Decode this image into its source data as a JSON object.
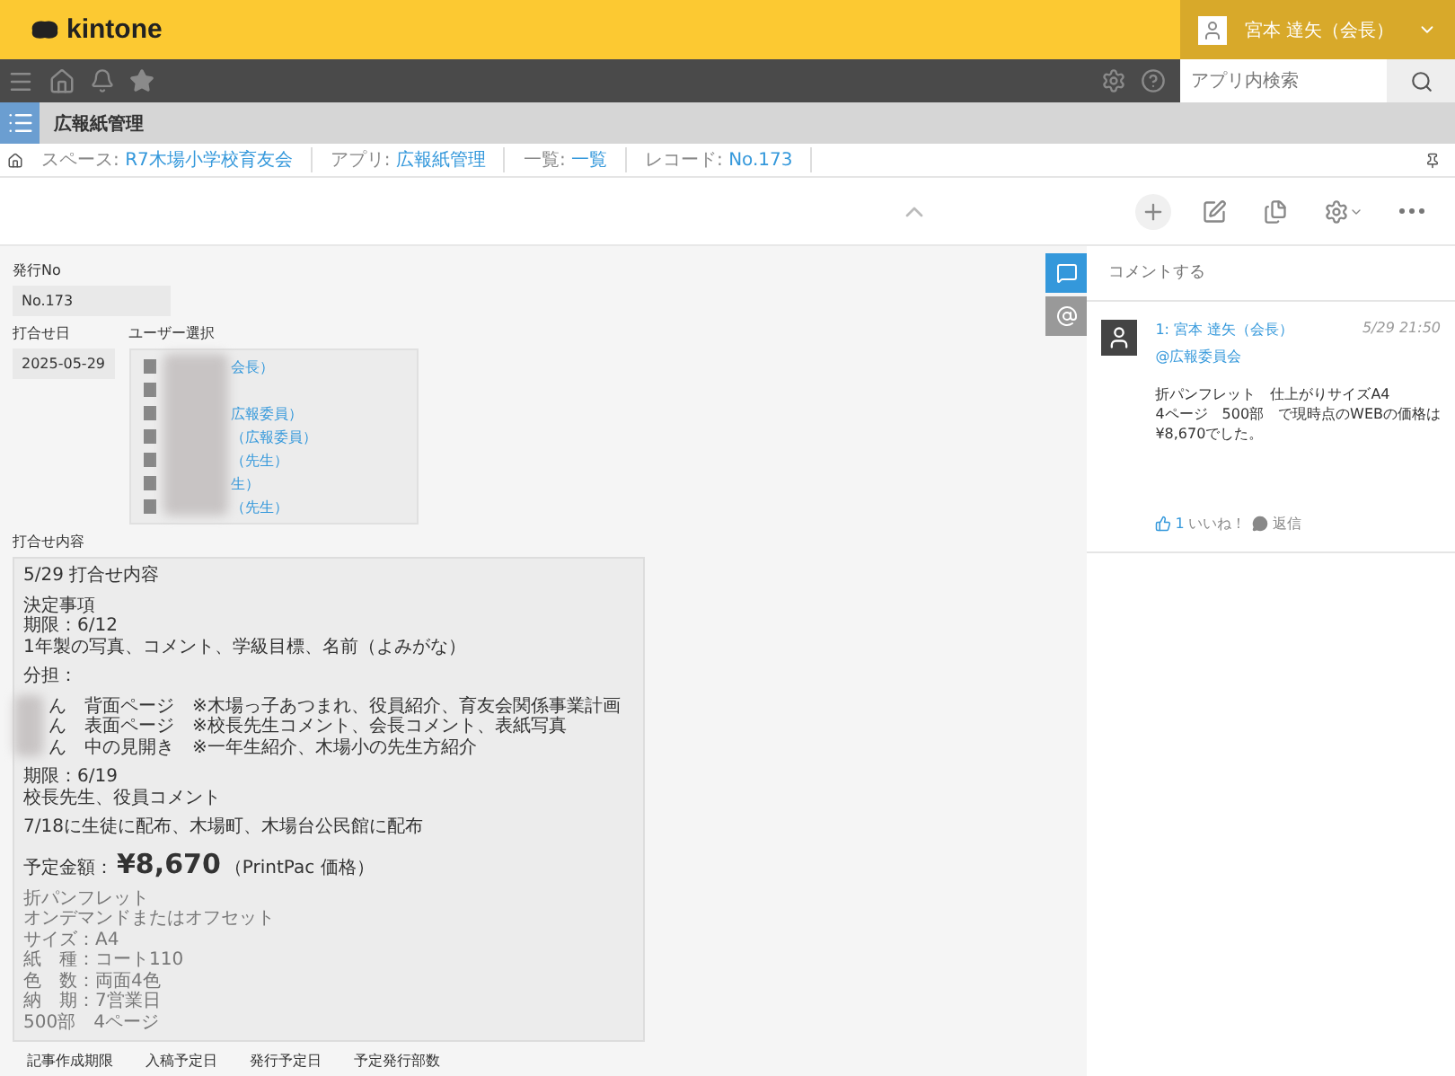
{
  "header": {
    "logo": "kintone",
    "user": "宮本 達矢（会長）"
  },
  "nav": {
    "search_placeholder": "アプリ内検索"
  },
  "app_title": "広報紙管理",
  "breadcrumbs": [
    {
      "prefix": "スペース:",
      "link": "R7木場小学校育友会"
    },
    {
      "prefix": "アプリ:",
      "link": "広報紙管理"
    },
    {
      "prefix": "一覧:",
      "link": "一覧"
    },
    {
      "prefix": "レコード:",
      "link": "No.173"
    }
  ],
  "record": {
    "issue_no": {
      "label": "発行No",
      "value": "No.173"
    },
    "meeting_date": {
      "label": "打合せ日",
      "value": "2025-05-29"
    },
    "users": {
      "label": "ユーザー選択",
      "items": [
        {
          "kind": "named",
          "suffix": "会長）"
        },
        {
          "kind": "blank"
        },
        {
          "kind": "named",
          "suffix": "広報委員）"
        },
        {
          "kind": "named",
          "suffix": "（広報委員）"
        },
        {
          "kind": "named",
          "suffix": "（先生）"
        },
        {
          "kind": "named",
          "suffix": "生）"
        },
        {
          "kind": "named",
          "suffix": "（先生）"
        }
      ]
    },
    "memo": {
      "label": "打合せ内容",
      "blocks": [
        {
          "kind": "text",
          "lines": [
            "5/29 打合せ内容"
          ]
        },
        {
          "kind": "text",
          "lines": [
            "決定事項",
            "期限：6/12",
            "1年製の写真、コメント、学級目標、名前（よみがな）"
          ]
        },
        {
          "kind": "text",
          "lines": [
            "分担："
          ]
        },
        {
          "kind": "redacted",
          "lines": [
            "ん　背面ページ　※木場っ子あつまれ、役員紹介、育友会関係事業計画",
            "ん　表面ページ　※校長先生コメント、会長コメント、表紙写真",
            "ん　中の見開き　※一年生紹介、木場小の先生方紹介"
          ]
        },
        {
          "kind": "text",
          "lines": [
            "期限：6/19",
            "校長先生、役員コメント"
          ]
        },
        {
          "kind": "text",
          "lines": [
            "7/18に生徒に配布、木場町、木場台公民館に配布"
          ]
        },
        {
          "kind": "price",
          "label": "予定金額：",
          "amount": "¥8,670",
          "note": "（PrintPac 価格）"
        },
        {
          "kind": "spec",
          "lines": [
            "折パンフレット",
            "オンデマンドまたはオフセット",
            "サイズ：A4",
            "紙　種：コート110",
            "色　数：両面4色",
            "納　期：7営業日",
            "500部　4ページ"
          ]
        }
      ]
    },
    "bottom_labels": [
      "記事作成期限",
      "入稿予定日",
      "発行予定日",
      "予定発行部数"
    ]
  },
  "side_tabs": [
    {
      "kind": "comment",
      "selected": true
    },
    {
      "kind": "mention",
      "selected": false
    }
  ],
  "comments": {
    "placeholder": "コメントする",
    "items": [
      {
        "number": "1:",
        "author": "宮本 達矢（会長）",
        "time": "5/29 21:50",
        "mention": "@広報委員会",
        "body": [
          "折パンフレット　仕上がりサイズA4",
          "4ページ　500部　で現時点のWEBの価格は",
          "¥8,670でした。"
        ],
        "like_count": "1",
        "like": "いいね！",
        "reply": "返信"
      }
    ]
  }
}
